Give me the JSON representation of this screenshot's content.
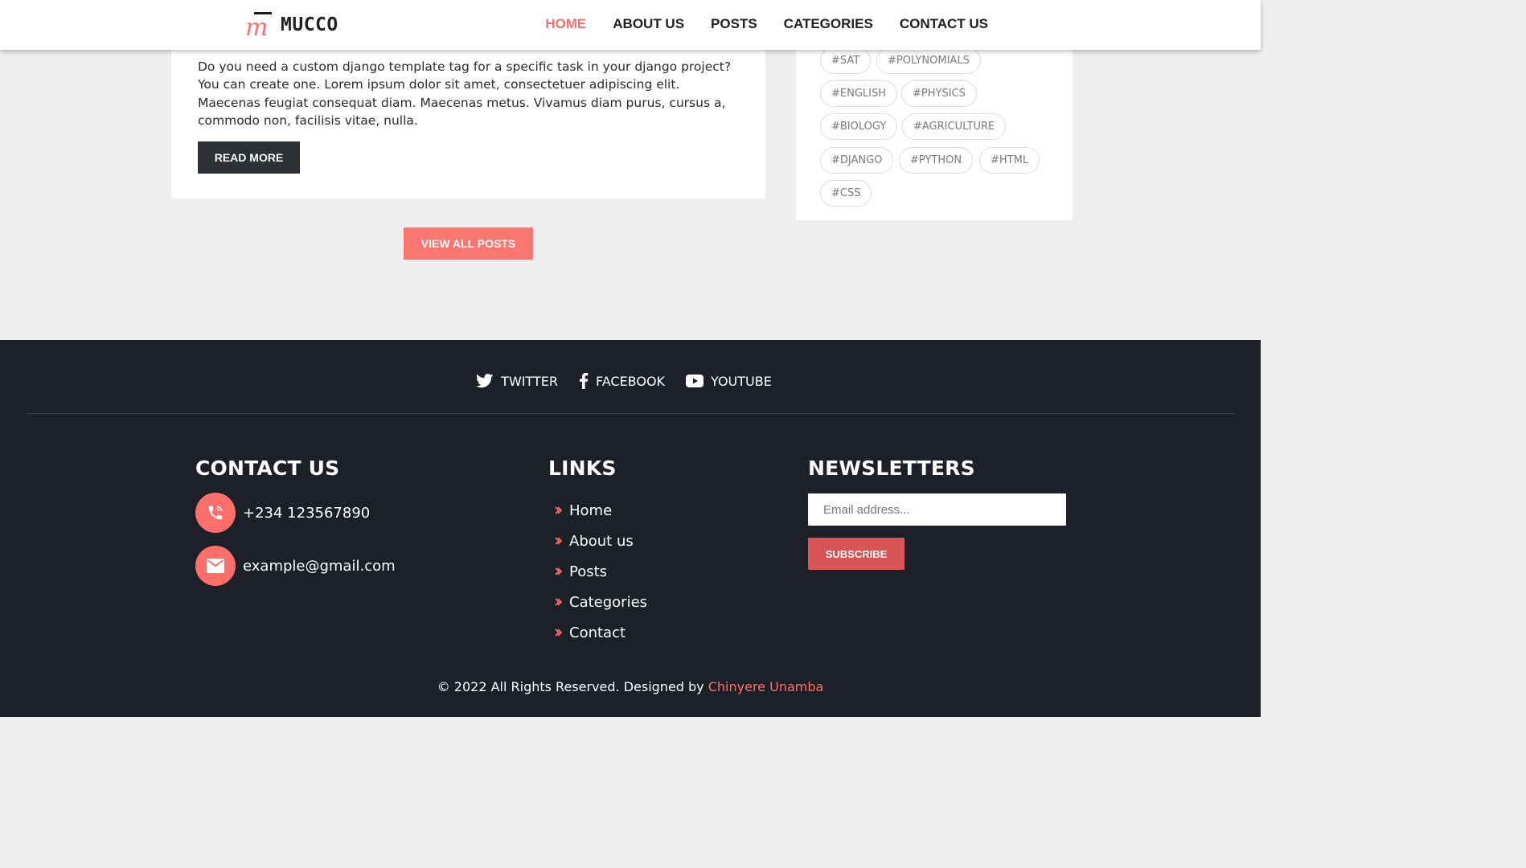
{
  "header": {
    "brand": "MUCCO",
    "nav": [
      "HOME",
      "ABOUT US",
      "POSTS",
      "CATEGORIES",
      "CONTACT US"
    ],
    "active_index": 0,
    "accent_color": "#fa6f6a"
  },
  "post": {
    "excerpt": "Do you need a custom django template tag for a specific task in your django project? You can create one. Lorem ipsum dolor sit amet, consectetuer adipiscing elit. Maecenas feugiat consequat diam. Maecenas metus. Vivamus diam purus, cursus a, commodo non, facilisis vitae, nulla.",
    "read_more_label": "READ MORE"
  },
  "view_all_label": "VIEW ALL POSTS",
  "tags": [
    "#SAT",
    "#POLYNOMIALS",
    "#ENGLISH",
    "#PHYSICS",
    "#BIOLOGY",
    "#AGRICULTURE",
    "#DJANGO",
    "#PYTHON",
    "#HTML",
    "#CSS"
  ],
  "footer": {
    "social": [
      {
        "label": "TWITTER",
        "icon": "twitter-icon"
      },
      {
        "label": "FACEBOOK",
        "icon": "facebook-icon"
      },
      {
        "label": "YOUTUBE",
        "icon": "youtube-icon"
      }
    ],
    "contact": {
      "title": "CONTACT US",
      "phone": "+234 123567890",
      "email": "example@gmail.com"
    },
    "links": {
      "title": "LINKS",
      "items": [
        "Home",
        "About us",
        "Posts",
        "Categories",
        "Contact"
      ]
    },
    "newsletter": {
      "title": "NEWSLETTERS",
      "placeholder": "Email address...",
      "button": "SUBSCRIBE"
    },
    "copyright": {
      "text": "© 2022 All Rights Reserved. Designed by ",
      "designer": "Chinyere Unamba"
    },
    "background_color": "#1d2029",
    "subscribe_color": "#d95454"
  }
}
